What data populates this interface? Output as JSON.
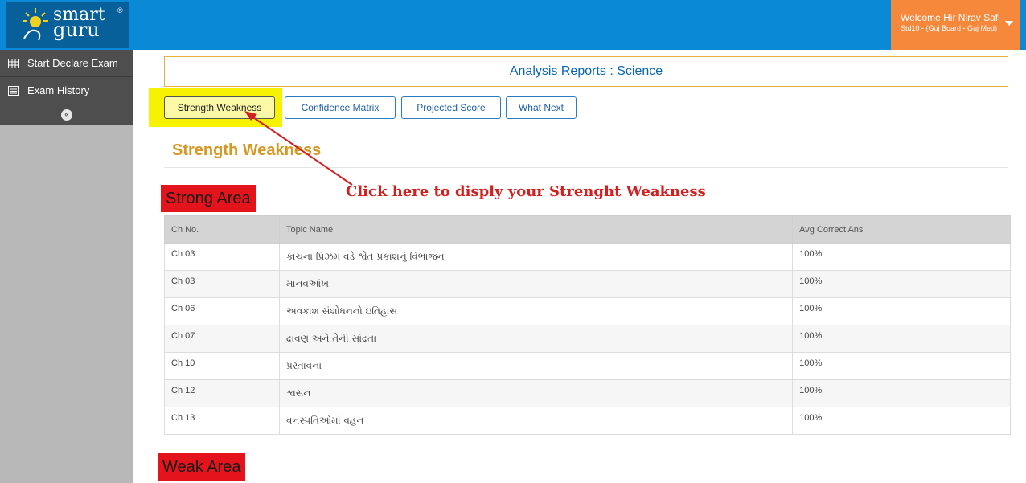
{
  "brand": {
    "line1": "smart",
    "line2": "guru",
    "registered": "®"
  },
  "user": {
    "welcome": "Welcome Hir Nirav Safi",
    "standard": "Std10 - (Guj Board - Guj Med)"
  },
  "sidebar": {
    "items": [
      {
        "label": "Start Declare Exam",
        "icon": "grid-icon"
      },
      {
        "label": "Exam History",
        "icon": "list-icon"
      }
    ],
    "collapse": "«"
  },
  "main": {
    "title": "Analysis Reports : Science",
    "tabs": [
      {
        "label": "Strength Weakness",
        "active": true
      },
      {
        "label": "Confidence Matrix",
        "active": false
      },
      {
        "label": "Projected Score",
        "active": false
      },
      {
        "label": "What Next",
        "active": false
      }
    ],
    "section_title": "Strength Weakness",
    "annotation": "Click here to disply your Strenght Weakness",
    "strong_area": "Strong Area",
    "weak_area": "Weak Area",
    "table": {
      "headers": [
        "Ch No.",
        "Topic Name",
        "Avg Correct Ans"
      ],
      "rows": [
        [
          "Ch 03",
          "કાચના પ્રિઝમ વડે શ્વેત પ્રકાશનું વિભાજન",
          "100%"
        ],
        [
          "Ch 03",
          "માનવઆંખ",
          "100%"
        ],
        [
          "Ch 06",
          "અવકાશ સંશોધનનો ઇતિહાસ",
          "100%"
        ],
        [
          "Ch 07",
          "દ્રાવણ અને તેની સાંદ્રતા",
          "100%"
        ],
        [
          "Ch 10",
          "પ્રસ્તાવના",
          "100%"
        ],
        [
          "Ch 12",
          "શ્વસન",
          "100%"
        ],
        [
          "Ch 13",
          "વનસ્પતિઓમાં વહન",
          "100%"
        ]
      ]
    }
  },
  "colors": {
    "topbar": "#0a8ad6",
    "accent": "#f6883c",
    "highlight": "#f7f200",
    "label_red": "#e4141c"
  }
}
